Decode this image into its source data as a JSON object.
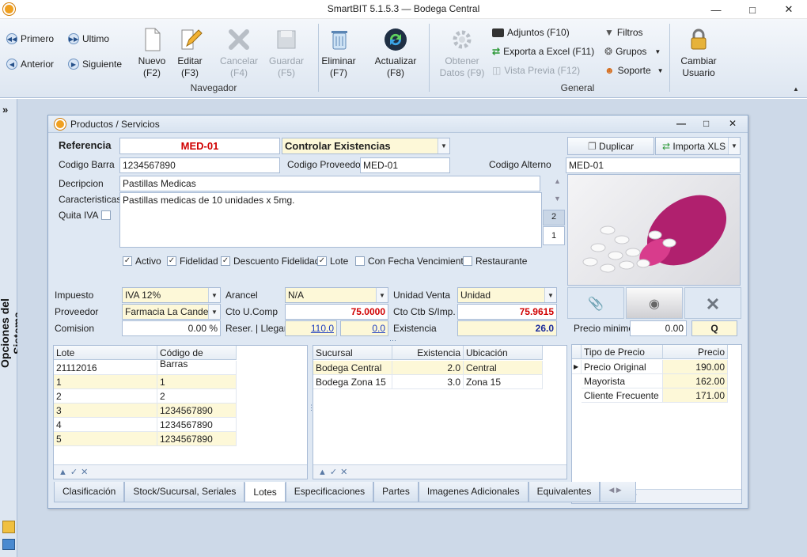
{
  "window": {
    "title": "SmartBIT 5.1.5.3 — Bodega Central"
  },
  "ribbon": {
    "nav": {
      "first": "Primero",
      "prev": "Anterior",
      "last": "Ultimo",
      "next": "Siguiente"
    },
    "buttons": {
      "new": [
        "Nuevo",
        "(F2)"
      ],
      "edit": [
        "Editar",
        "(F3)"
      ],
      "cancel": [
        "Cancelar",
        "(F4)"
      ],
      "save": [
        "Guardar",
        "(F5)"
      ],
      "delete": [
        "Eliminar",
        "(F7)"
      ],
      "refresh": [
        "Actualizar",
        "(F8)"
      ],
      "fetch": [
        "Obtener",
        "Datos (F9)"
      ],
      "user": [
        "Cambiar",
        "Usuario"
      ]
    },
    "general": {
      "attachments": "Adjuntos (F10)",
      "excel": "Exporta a Excel (F11)",
      "preview": "Vista Previa (F12)",
      "filters": "Filtros",
      "groups": "Grupos",
      "support": "Soporte"
    },
    "group_labels": {
      "nav": "Navegador",
      "general": "General"
    }
  },
  "side_panel": {
    "label": "Opciones del Sistema"
  },
  "form": {
    "title": "Productos / Servicios",
    "referencia_label": "Referencia",
    "referencia": "MED-01",
    "control_mode": "Controlar Existencias",
    "duplicate": "Duplicar",
    "import": "Importa XLS",
    "barcode_label": "Codigo Barra",
    "barcode": "1234567890",
    "supplier_code_label": "Codigo Proveedor",
    "supplier_code": "MED-01",
    "alt_code_label": "Codigo Alterno",
    "alt_code": "MED-01",
    "desc_label": "Decripcion",
    "desc": "Pastillas Medicas",
    "chars_label": "Caracteristicas",
    "chars": "Pastillas medicas de 10 unidades x 5mg.",
    "quita_iva_label": "Quita IVA",
    "pages": [
      "2",
      "1"
    ],
    "flags": [
      {
        "label": "Activo",
        "checked": "✓"
      },
      {
        "label": "Fidelidad",
        "checked": "✓"
      },
      {
        "label": "Descuento Fidelidad",
        "checked": "✓"
      },
      {
        "label": "Lote",
        "checked": "✓"
      },
      {
        "label": "Con Fecha Vencimiento",
        "checked": ""
      },
      {
        "label": "Restaurante",
        "checked": ""
      }
    ],
    "impuesto_label": "Impuesto",
    "impuesto": "IVA 12%",
    "proveedor_label": "Proveedor",
    "proveedor": "Farmacia La Candelaria",
    "comision_label": "Comision",
    "comision": "0.00 %",
    "arancel_label": "Arancel",
    "arancel": "N/A",
    "cto_comp_label": "Cto U.Comp",
    "cto_comp": "75.0000",
    "reser_label": "Reser. | Llegar",
    "reser": "110.0",
    "llegar": "0.0",
    "unidad_label": "Unidad Venta",
    "unidad": "Unidad",
    "cto_ctb_label": "Cto Ctb S/Imp.",
    "cto_ctb": "75.9615",
    "existencia_label": "Existencia",
    "existencia": "26.0",
    "precio_min_label": "Precio minimo",
    "precio_min": "0.00",
    "q": "Q"
  },
  "lotes": {
    "headers": [
      "Lote",
      "Código de Barras"
    ],
    "rows": [
      [
        "21112016",
        ""
      ],
      [
        "1",
        "1"
      ],
      [
        "2",
        "2"
      ],
      [
        "3",
        "1234567890"
      ],
      [
        "4",
        "1234567890"
      ],
      [
        "5",
        "1234567890"
      ]
    ]
  },
  "stock": {
    "headers": [
      "Sucursal",
      "Existencia",
      "Ubicación"
    ],
    "rows": [
      [
        "Bodega Central",
        "2.0",
        "Central"
      ],
      [
        "Bodega Zona 15",
        "3.0",
        "Zona 15"
      ]
    ]
  },
  "precios": {
    "headers": [
      "Tipo de Precio",
      "Precio"
    ],
    "rows": [
      [
        "Precio Original",
        "190.00"
      ],
      [
        "Mayorista",
        "162.00"
      ],
      [
        "Cliente Frecuente",
        "171.00"
      ]
    ]
  },
  "tabs": [
    "Clasificación",
    "Stock/Sucursal, Seriales",
    "Lotes",
    "Especificaciones",
    "Partes",
    "Imagenes Adicionales",
    "Equivalentes"
  ],
  "active_tab": "Lotes"
}
